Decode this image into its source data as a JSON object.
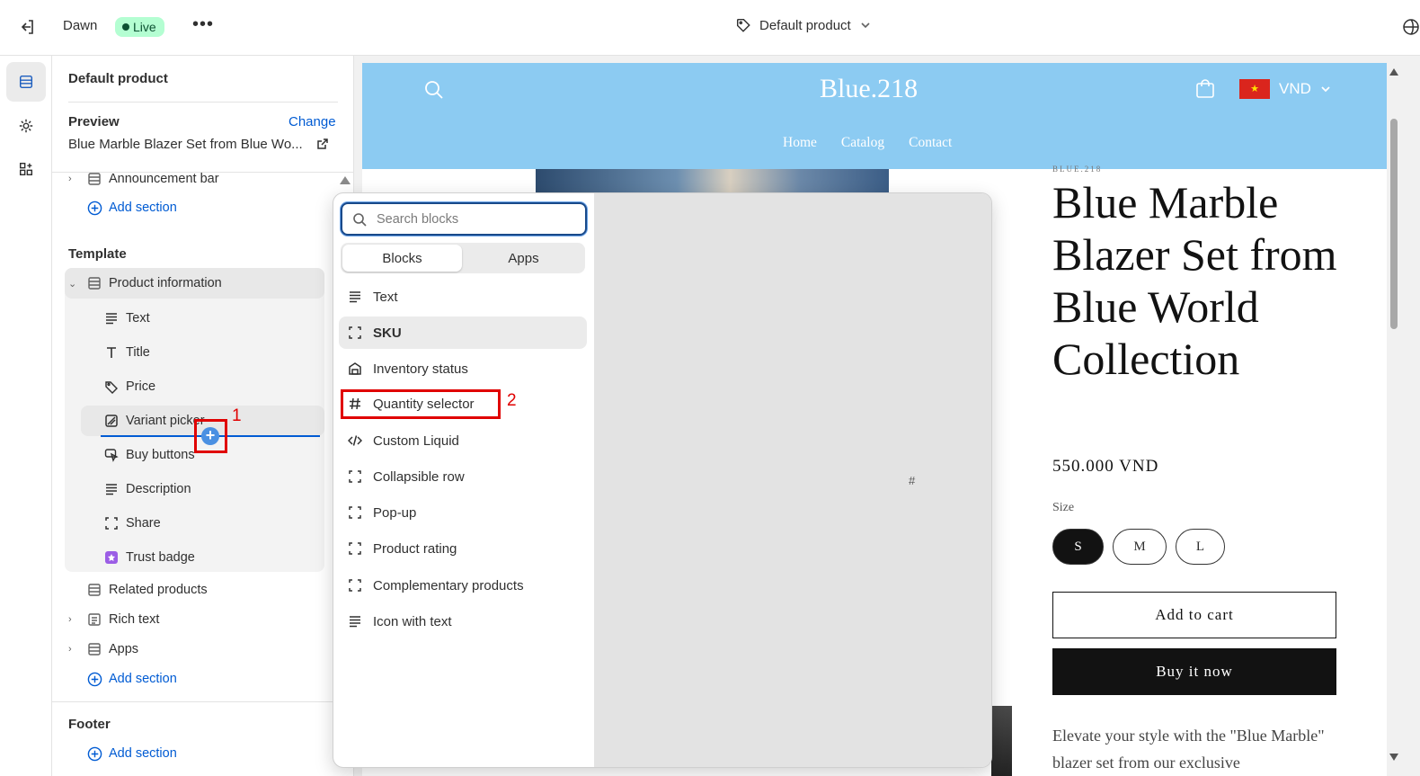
{
  "topbar": {
    "theme_name": "Dawn",
    "status_badge": "Live",
    "more_label": "•••",
    "template_select": "Default product"
  },
  "sidebar": {
    "title": "Default product",
    "preview_label": "Preview",
    "change_label": "Change",
    "preview_product": "Blue Marble Blazer Set from Blue Wo...",
    "header_items": [
      {
        "label": "Announcement bar"
      }
    ],
    "add_section": "Add section",
    "template_heading": "Template",
    "product_information": "Product information",
    "blocks": [
      {
        "label": "Text",
        "icon": "text-icon"
      },
      {
        "label": "Title",
        "icon": "title-icon"
      },
      {
        "label": "Price",
        "icon": "price-tag-icon"
      },
      {
        "label": "Variant picker",
        "icon": "variant-icon"
      },
      {
        "label": "Buy buttons",
        "icon": "cursor-icon"
      },
      {
        "label": "Description",
        "icon": "text-icon"
      },
      {
        "label": "Share",
        "icon": "share-icon"
      },
      {
        "label": "Trust badge",
        "icon": "app-icon"
      }
    ],
    "sections": [
      {
        "label": "Related products"
      },
      {
        "label": "Rich text"
      },
      {
        "label": "Apps"
      }
    ],
    "footer_heading": "Footer",
    "annotation_1": "1"
  },
  "picker": {
    "search_placeholder": "Search blocks",
    "tabs": [
      "Blocks",
      "Apps"
    ],
    "items": [
      {
        "label": "Text",
        "icon": "text-icon"
      },
      {
        "label": "SKU",
        "icon": "block-icon"
      },
      {
        "label": "Inventory status",
        "icon": "inventory-icon"
      },
      {
        "label": "Quantity selector",
        "icon": "hash-icon"
      },
      {
        "label": "Custom Liquid",
        "icon": "code-icon"
      },
      {
        "label": "Collapsible row",
        "icon": "block-icon"
      },
      {
        "label": "Pop-up",
        "icon": "block-icon"
      },
      {
        "label": "Product rating",
        "icon": "block-icon"
      },
      {
        "label": "Complementary products",
        "icon": "block-icon"
      },
      {
        "label": "Icon with text",
        "icon": "text-icon"
      }
    ],
    "preview_glyph": "#",
    "annotation_2": "2"
  },
  "store": {
    "name": "Blue.218",
    "nav": [
      "Home",
      "Catalog",
      "Contact"
    ],
    "currency": "VND",
    "flag_star": "★",
    "brand_mini": "BLUE.218",
    "product_title": "Blue Marble Blazer Set from Blue World Collection",
    "price": "550.000 VND",
    "size_label": "Size",
    "sizes": [
      "S",
      "M",
      "L"
    ],
    "selected_size": "S",
    "add_to_cart": "Add to cart",
    "buy_now": "Buy it now",
    "description": "Elevate your style with the \"Blue Marble\" blazer set from our exclusive"
  },
  "colors": {
    "accent": "#005bd3",
    "store_header": "#8ccbf2",
    "live_badge": "#b4fed2",
    "annotation": "#e00000"
  }
}
